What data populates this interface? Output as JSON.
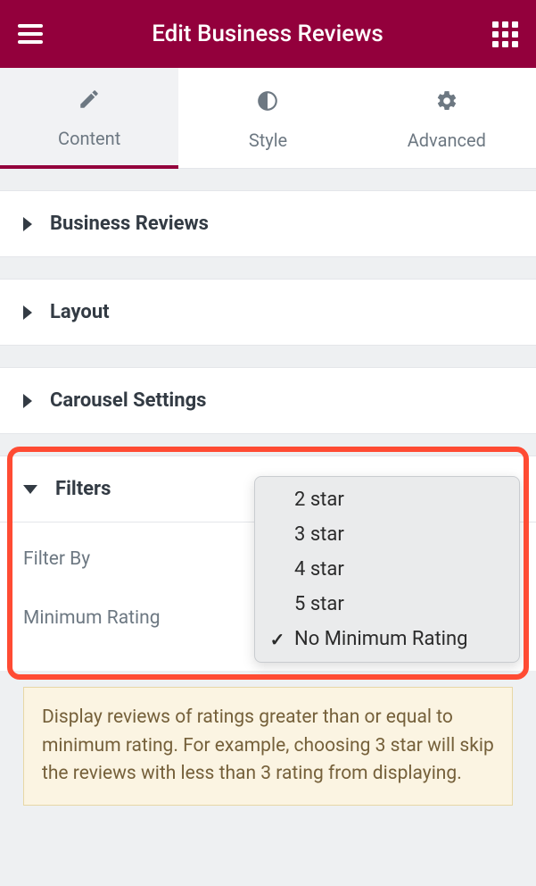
{
  "header": {
    "title": "Edit Business Reviews"
  },
  "tabs": [
    {
      "label": "Content",
      "icon": "pencil",
      "active": true
    },
    {
      "label": "Style",
      "icon": "contrast",
      "active": false
    },
    {
      "label": "Advanced",
      "icon": "gear",
      "active": false
    }
  ],
  "sections": {
    "business_reviews": {
      "title": "Business Reviews",
      "expanded": false
    },
    "layout": {
      "title": "Layout",
      "expanded": false
    },
    "carousel": {
      "title": "Carousel Settings",
      "expanded": false
    },
    "filters": {
      "title": "Filters",
      "expanded": true,
      "fields": {
        "filter_by": {
          "label": "Filter By"
        },
        "minimum_rating": {
          "label": "Minimum Rating"
        }
      }
    }
  },
  "dropdown": {
    "options": [
      {
        "label": "2 star",
        "selected": false
      },
      {
        "label": "3 star",
        "selected": false
      },
      {
        "label": "4 star",
        "selected": false
      },
      {
        "label": "5 star",
        "selected": false
      },
      {
        "label": "No Minimum Rating",
        "selected": true
      }
    ]
  },
  "info": {
    "text": "Display reviews of ratings greater than or equal to minimum rating. For example, choosing 3 star will skip the reviews with less than 3 rating from displaying."
  }
}
